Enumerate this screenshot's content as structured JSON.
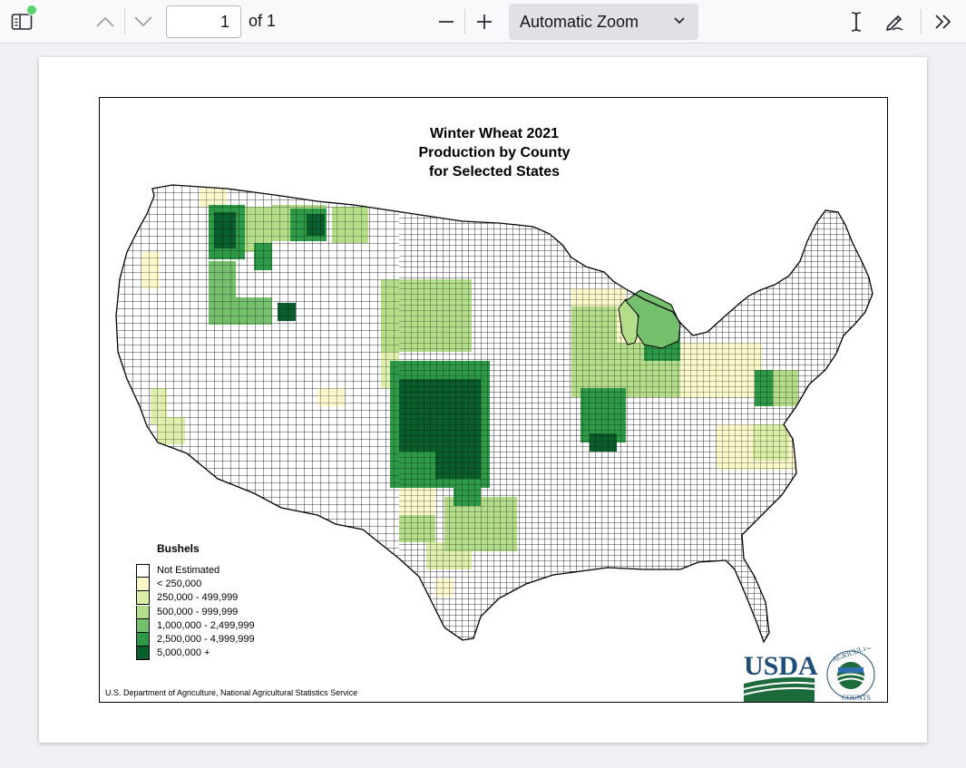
{
  "toolbar": {
    "sidebar_icon": "sidebar-toggle-icon",
    "page_number": "1",
    "page_of": "of 1",
    "zoom_value": "Automatic Zoom",
    "notification_color": "#54d46a"
  },
  "map": {
    "title_lines": [
      "Winter Wheat 2021",
      "Production by County",
      "for Selected States"
    ],
    "legend_title": "Bushels",
    "legend_items": [
      {
        "label": "Not Estimated",
        "color": "#ffffff"
      },
      {
        "label": "< 250,000",
        "color": "#fbf8c8"
      },
      {
        "label": "250,000 - 499,999",
        "color": "#dcefa6"
      },
      {
        "label": "500,000 - 999,999",
        "color": "#b4dd8a"
      },
      {
        "label": "1,000,000 - 2,499,999",
        "color": "#74c06c"
      },
      {
        "label": "2,500,000 - 4,999,999",
        "color": "#2e9a48"
      },
      {
        "label": "5,000,000 +",
        "color": "#0a5e2b"
      }
    ],
    "credit": "U.S. Department of Agriculture, National Agricultural Statistics Service",
    "logo": {
      "wordmark": "USDA",
      "ring_text": "AGRICULTURE COUNTS",
      "brand_color": "#1f4e79",
      "green": "#1d6b3a"
    }
  }
}
